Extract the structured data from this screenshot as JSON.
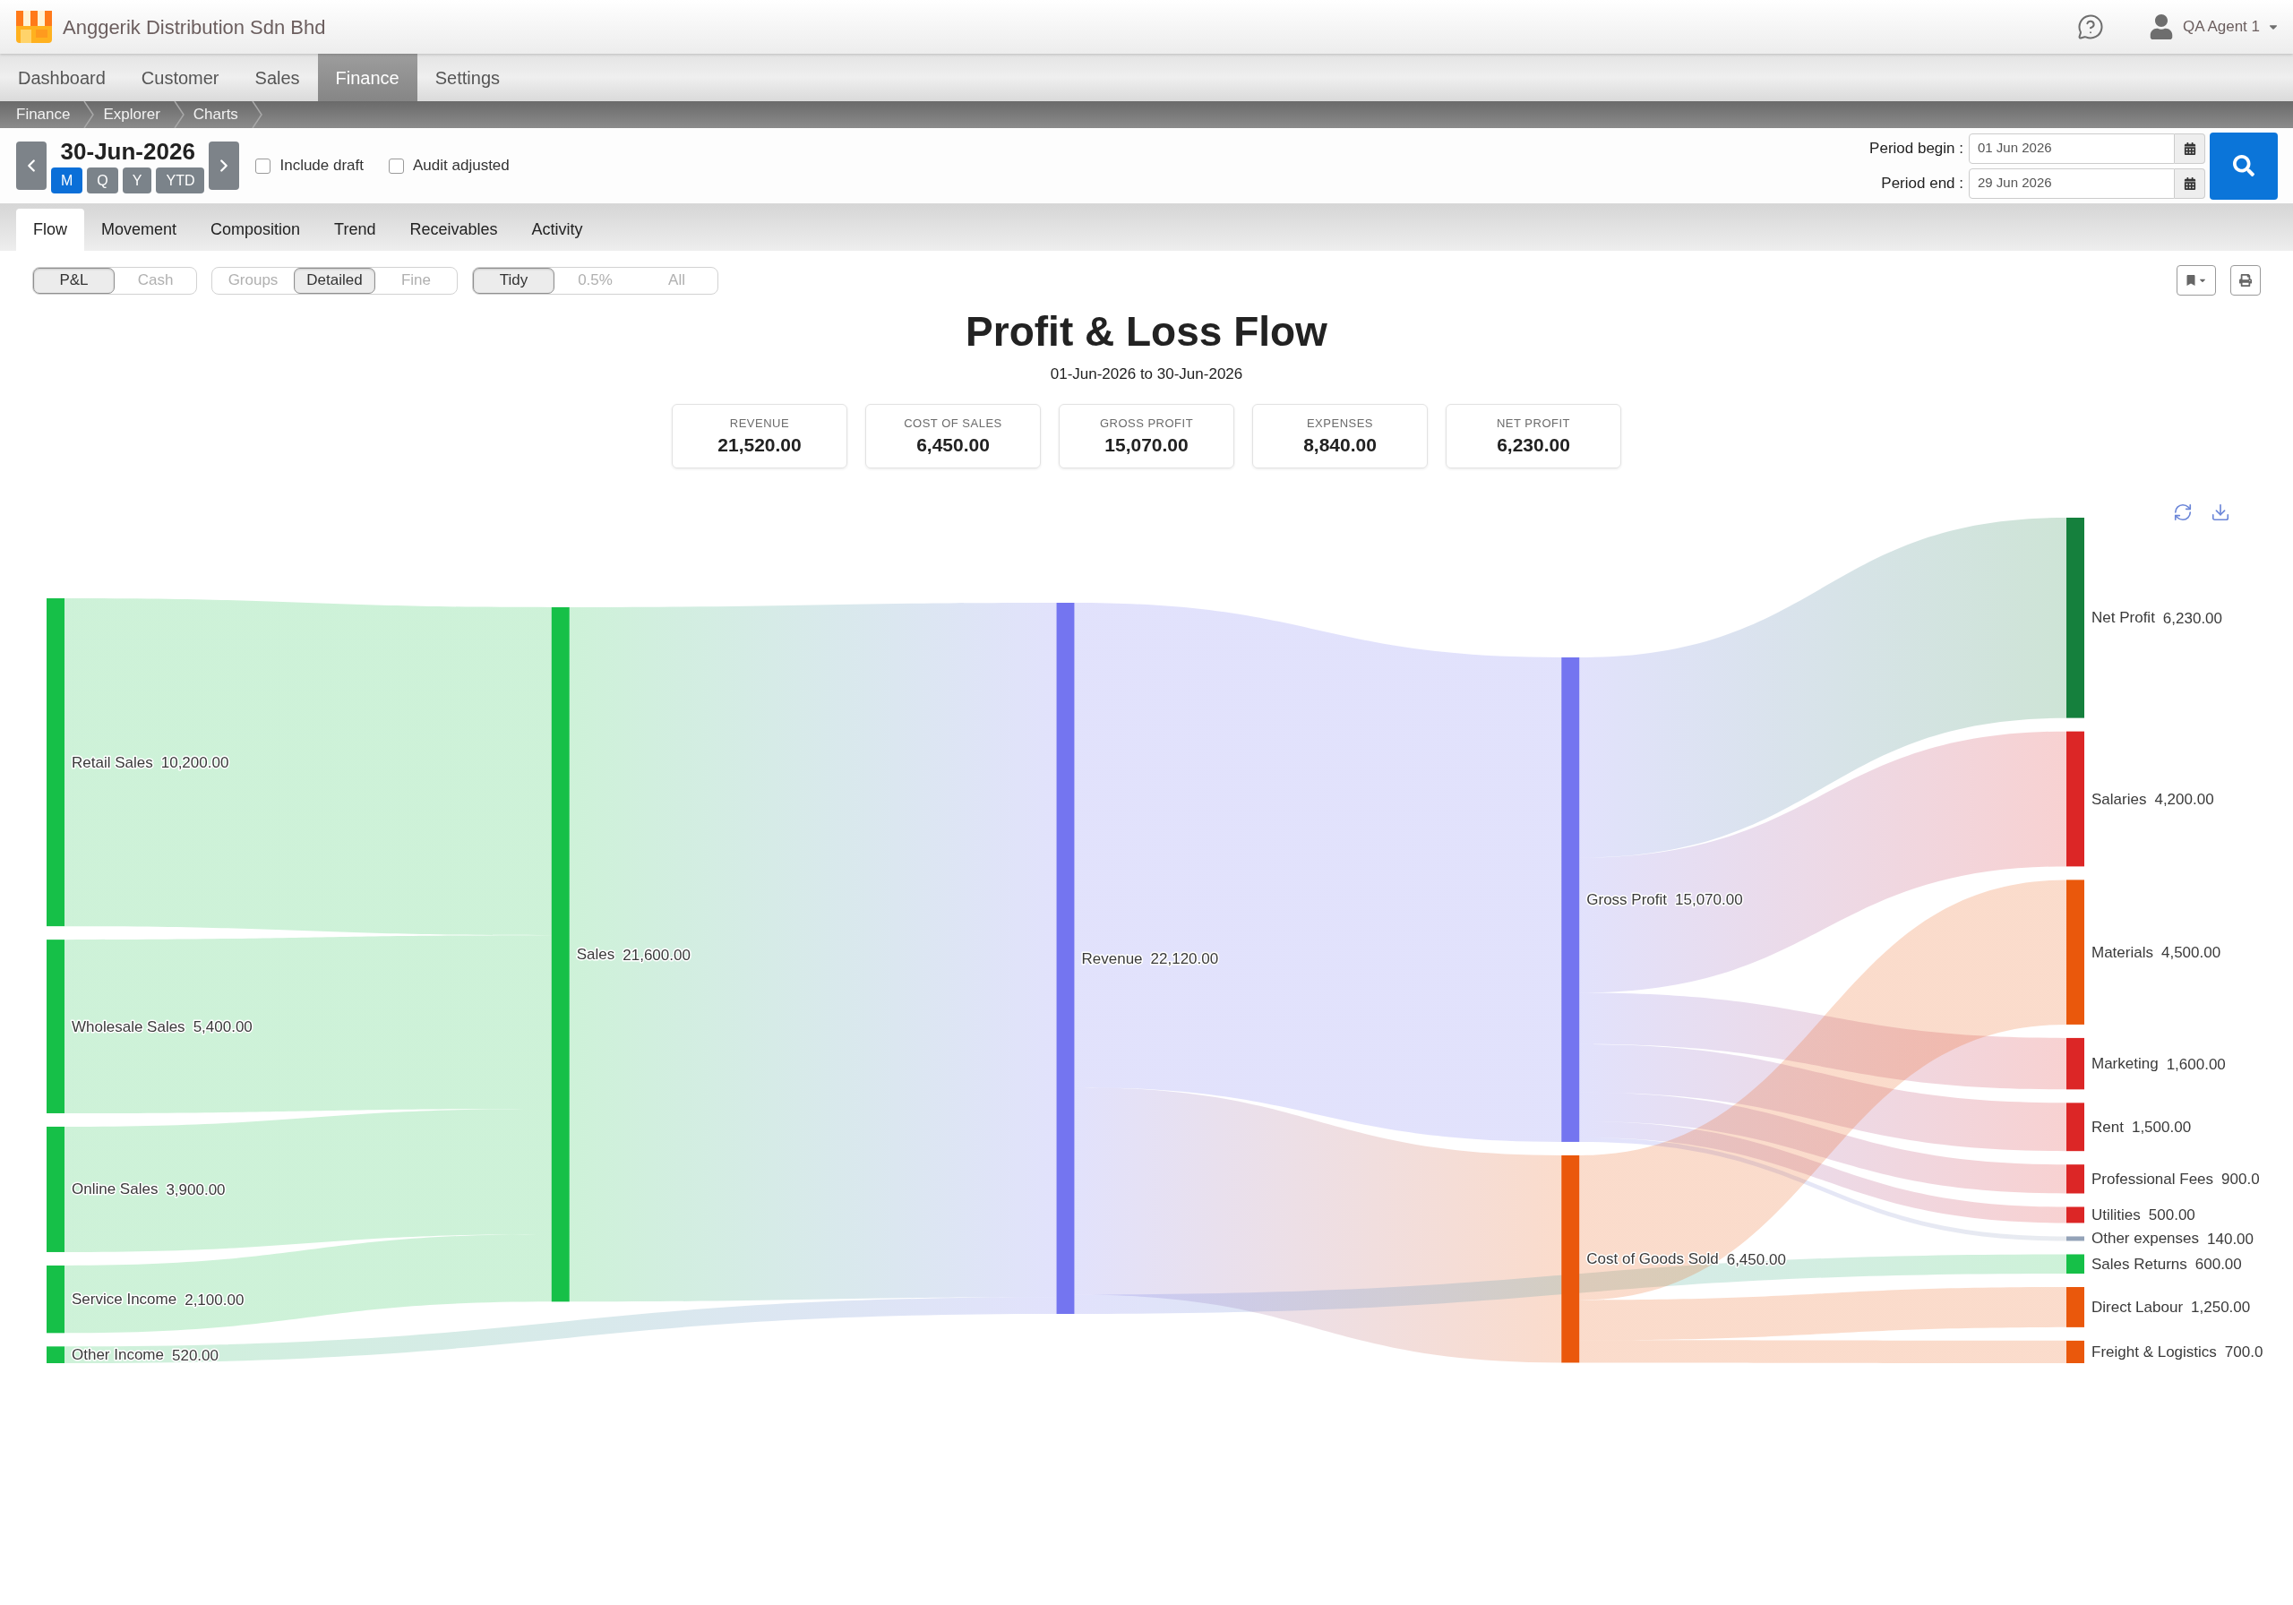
{
  "header": {
    "company": "Anggerik Distribution Sdn Bhd",
    "user": "QA Agent 1"
  },
  "nav": [
    {
      "label": "Dashboard",
      "selected": false
    },
    {
      "label": "Customer",
      "selected": false
    },
    {
      "label": "Sales",
      "selected": false
    },
    {
      "label": "Finance",
      "selected": true
    },
    {
      "label": "Settings",
      "selected": false
    }
  ],
  "breadcrumb": [
    "Finance",
    "Explorer",
    "Charts"
  ],
  "date_bar": {
    "date": "30-Jun-2026",
    "periods": [
      {
        "label": "M",
        "selected": true
      },
      {
        "label": "Q",
        "selected": false
      },
      {
        "label": "Y",
        "selected": false
      },
      {
        "label": "YTD",
        "selected": false
      }
    ],
    "options": [
      {
        "label": "Include draft",
        "checked": false
      },
      {
        "label": "Audit adjusted",
        "checked": false
      }
    ],
    "period_begin": {
      "label": "Period begin :",
      "value": "01 Jun 2026"
    },
    "period_end": {
      "label": "Period end :",
      "value": "29 Jun 2026"
    }
  },
  "tabs": [
    {
      "label": "Flow",
      "selected": true
    },
    {
      "label": "Movement",
      "selected": false
    },
    {
      "label": "Composition",
      "selected": false
    },
    {
      "label": "Trend",
      "selected": false
    },
    {
      "label": "Receivables",
      "selected": false
    },
    {
      "label": "Activity",
      "selected": false
    }
  ],
  "view_toggles": [
    {
      "options": [
        {
          "label": "P&L",
          "selected": true
        },
        {
          "label": "Cash",
          "selected": false
        }
      ]
    },
    {
      "options": [
        {
          "label": "Groups",
          "selected": false
        },
        {
          "label": "Detailed",
          "selected": true
        },
        {
          "label": "Fine",
          "selected": false
        }
      ]
    },
    {
      "options": [
        {
          "label": "Tidy",
          "selected": true
        },
        {
          "label": "0.5%",
          "selected": false
        },
        {
          "label": "All",
          "selected": false
        }
      ]
    }
  ],
  "report": {
    "title": "Profit & Loss Flow",
    "subtitle": "01-Jun-2026 to 30-Jun-2026",
    "kpis": [
      {
        "label": "REVENUE",
        "value": "21,520.00"
      },
      {
        "label": "COST OF SALES",
        "value": "6,450.00"
      },
      {
        "label": "GROSS PROFIT",
        "value": "15,070.00"
      },
      {
        "label": "EXPENSES",
        "value": "8,840.00"
      },
      {
        "label": "NET PROFIT",
        "value": "6,230.00"
      }
    ],
    "sankey": {
      "nodes": [
        {
          "label": "Retail Sales",
          "value": "10,200.00",
          "color": "#16c048"
        },
        {
          "label": "Wholesale Sales",
          "value": "5,400.00",
          "color": "#16c048"
        },
        {
          "label": "Online Sales",
          "value": "3,900.00",
          "color": "#16c048"
        },
        {
          "label": "Service Income",
          "value": "2,100.00",
          "color": "#16c048"
        },
        {
          "label": "Other Income",
          "value": "520.00",
          "color": "#16c048"
        },
        {
          "label": "Sales",
          "value": "21,600.00",
          "color": "#16c048"
        },
        {
          "label": "Revenue",
          "value": "22,120.00",
          "color": "#7475f0"
        },
        {
          "label": "Gross Profit",
          "value": "15,070.00",
          "color": "#7475f0"
        },
        {
          "label": "Cost of Goods Sold",
          "value": "6,450.00",
          "color": "#ea580c"
        },
        {
          "label": "Net Profit",
          "value": "6,230.00",
          "color": "#15803d"
        },
        {
          "label": "Salaries",
          "value": "4,200.00",
          "color": "#dc2626"
        },
        {
          "label": "Materials",
          "value": "4,500.00",
          "color": "#ea580c"
        },
        {
          "label": "Marketing",
          "value": "1,600.00",
          "color": "#dc2626"
        },
        {
          "label": "Rent",
          "value": "1,500.00",
          "color": "#dc2626"
        },
        {
          "label": "Professional Fees",
          "value": "900.0",
          "color": "#dc2626"
        },
        {
          "label": "Utilities",
          "value": "500.00",
          "color": "#dc2626"
        },
        {
          "label": "Other expenses",
          "value": "140.00",
          "color": "#94a3b8"
        },
        {
          "label": "Sales Returns",
          "value": "600.00",
          "color": "#16c048"
        },
        {
          "label": "Direct Labour",
          "value": "1,250.00",
          "color": "#ea580c"
        },
        {
          "label": "Freight & Logistics",
          "value": "700.0",
          "color": "#ea580c"
        }
      ]
    }
  }
}
